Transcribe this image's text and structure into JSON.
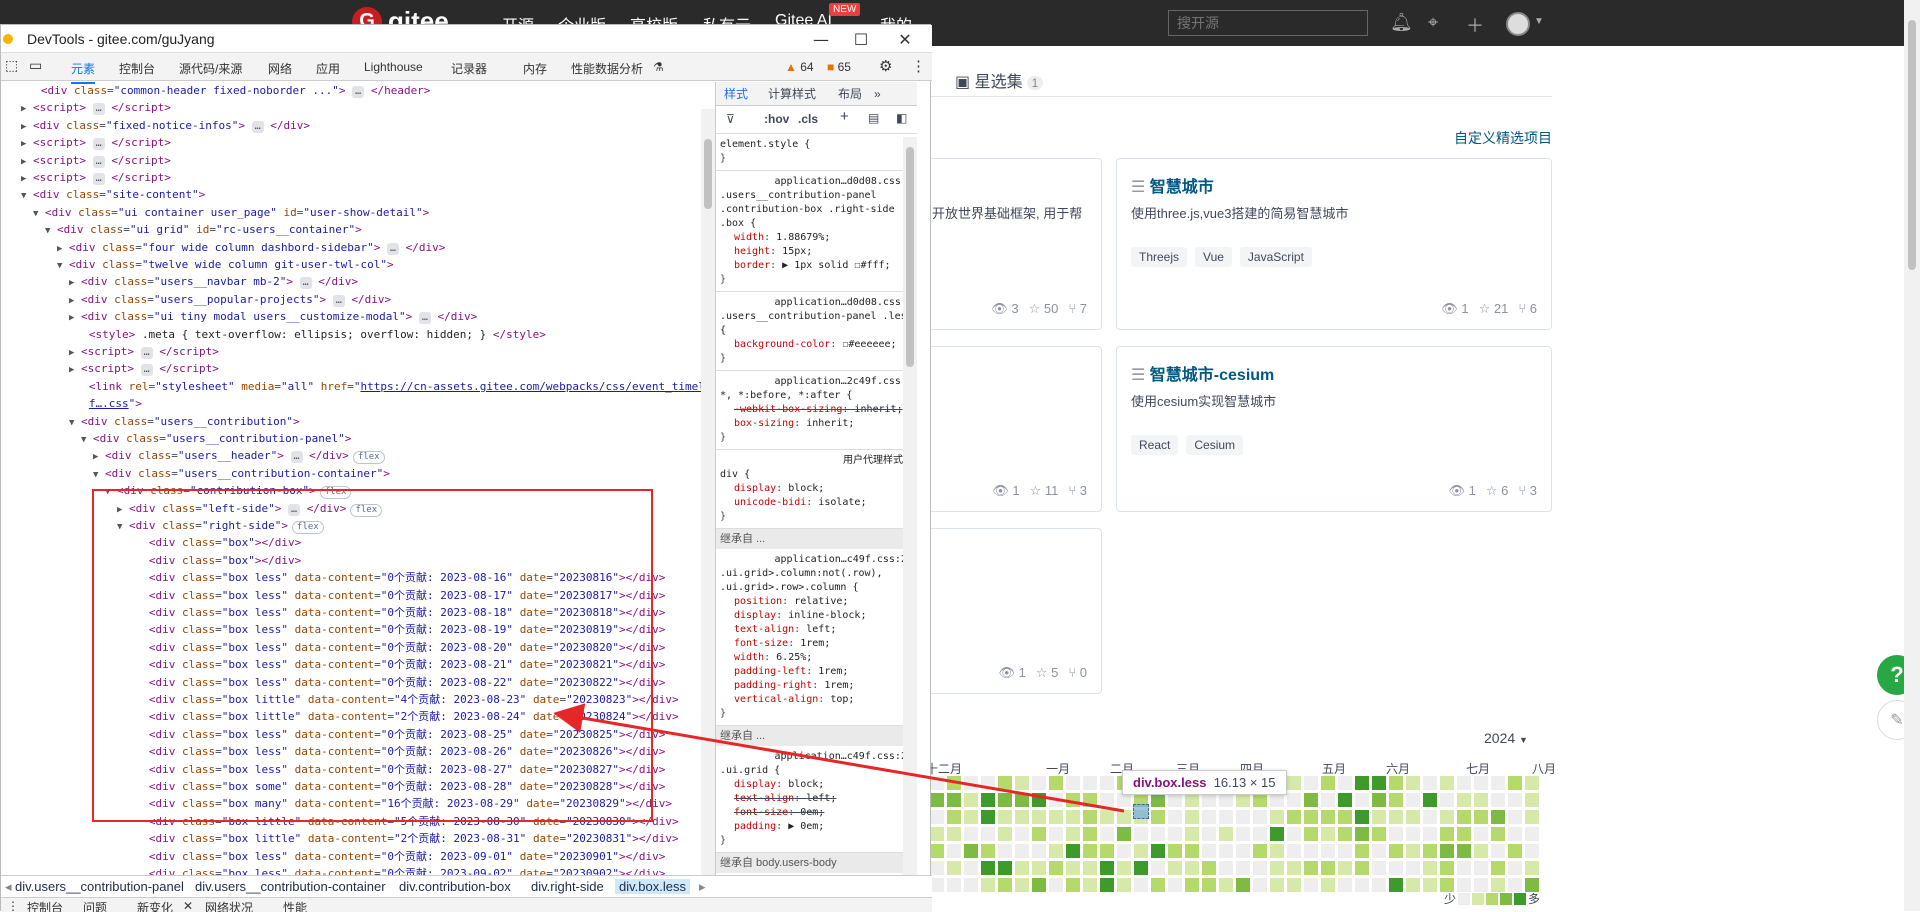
{
  "site": {
    "logo_text": "gitee",
    "nav": [
      "开源",
      "企业版",
      "高校版",
      "私有云",
      "Gitee AI",
      "我的"
    ],
    "new_badge": "NEW",
    "search_placeholder": "搜开源",
    "stars_tab": "星选集",
    "stars_count": "1",
    "custom_link": "自定义精选项目",
    "help_label": "?",
    "year": "2024",
    "months": [
      "十二月",
      "一月",
      "二月",
      "三月",
      "四月",
      "五月",
      "六月",
      "七月",
      "八月"
    ],
    "legend_less": "少",
    "legend_more": "多",
    "tooltip_tag": "div.box.less",
    "tooltip_size": "16.13 × 15",
    "colors": {
      "lvl0": "#eeeeee",
      "lvl1": "#d7e9a8",
      "lvl2": "#b5d96b",
      "lvl3": "#7dbb42",
      "lvl4": "#3d9a2b",
      "link": "#005980",
      "help": "#28a745"
    }
  },
  "cards": [
    {
      "title": "智慧城市",
      "desc": "使用three.js,vue3搭建的简易智慧城市",
      "tags": [
        "Threejs",
        "Vue",
        "JavaScript"
      ],
      "watch": "1",
      "star": "21",
      "fork": "6"
    },
    {
      "title": "智慧城市-cesium",
      "desc": "使用cesium实现智慧城市",
      "tags": [
        "React",
        "Cesium"
      ],
      "watch": "1",
      "star": "6",
      "fork": "3"
    }
  ],
  "left_cards": [
    {
      "desc": "开放世界基础框架, 用于帮",
      "watch": "3",
      "star": "50",
      "fork": "7"
    },
    {
      "desc": "",
      "watch": "1",
      "star": "11",
      "fork": "3"
    },
    {
      "desc": "",
      "watch": "1",
      "star": "5",
      "fork": "0"
    }
  ],
  "devtools": {
    "title": "DevTools - gitee.com/guJyang",
    "tabs": [
      "元素",
      "控制台",
      "源代码/来源",
      "网络",
      "应用",
      "Lighthouse",
      "记录器",
      "内存",
      "性能数据分析"
    ],
    "warn_count": "64",
    "issue_count": "65",
    "styles_tabs": [
      "样式",
      "计算样式",
      "布局"
    ],
    "filter_hov": ":hov",
    "filter_cls": ".cls",
    "breadcrumbs": [
      "div.users__contribution-panel",
      "div.users__contribution-container",
      "div.contribution-box",
      "div.right-side",
      "div.box.less"
    ],
    "drawer": [
      "控制台",
      "问题",
      "新变化",
      "网络状况",
      "性能"
    ]
  },
  "dom_lines": [
    {
      "d": 1,
      "a": "",
      "h": "<span class='tg'>&lt;div</span> <span class='at'>class</span>=<span class='av'>\"common-header fixed-noborder ...\"</span><span class='tg'>&gt;</span> <span class='ell'>…</span> <span class='tg'>&lt;/header&gt;</span>"
    },
    {
      "d": 1,
      "a": "▶",
      "h": "<span class='tg'>&lt;script&gt;</span> <span class='ell'>…</span> <span class='tg'>&lt;/script&gt;</span>"
    },
    {
      "d": 1,
      "a": "▶",
      "h": "<span class='tg'>&lt;div</span> <span class='at'>class</span>=<span class='av'>\"fixed-notice-infos\"</span><span class='tg'>&gt;</span> <span class='ell'>…</span> <span class='tg'>&lt;/div&gt;</span>"
    },
    {
      "d": 1,
      "a": "▶",
      "h": "<span class='tg'>&lt;script&gt;</span> <span class='ell'>…</span> <span class='tg'>&lt;/script&gt;</span>"
    },
    {
      "d": 1,
      "a": "▶",
      "h": "<span class='tg'>&lt;script&gt;</span> <span class='ell'>…</span> <span class='tg'>&lt;/script&gt;</span>"
    },
    {
      "d": 1,
      "a": "▶",
      "h": "<span class='tg'>&lt;script&gt;</span> <span class='ell'>…</span> <span class='tg'>&lt;/script&gt;</span>"
    },
    {
      "d": 1,
      "a": "▼",
      "h": "<span class='tg'>&lt;div</span> <span class='at'>class</span>=<span class='av'>\"site-content\"</span><span class='tg'>&gt;</span>"
    },
    {
      "d": 2,
      "a": "▼",
      "h": "<span class='tg'>&lt;div</span> <span class='at'>class</span>=<span class='av'>\"ui container user_page\"</span> <span class='at'>id</span>=<span class='av'>\"user-show-detail\"</span><span class='tg'>&gt;</span>"
    },
    {
      "d": 3,
      "a": "▼",
      "h": "<span class='tg'>&lt;div</span> <span class='at'>class</span>=<span class='av'>\"ui grid\"</span> <span class='at'>id</span>=<span class='av'>\"rc-users__container\"</span><span class='tg'>&gt;</span>"
    },
    {
      "d": 4,
      "a": "▶",
      "h": "<span class='tg'>&lt;div</span> <span class='at'>class</span>=<span class='av'>\"four wide column dashbord-sidebar\"</span><span class='tg'>&gt;</span> <span class='ell'>…</span> <span class='tg'>&lt;/div&gt;</span>"
    },
    {
      "d": 4,
      "a": "▼",
      "h": "<span class='tg'>&lt;div</span> <span class='at'>class</span>=<span class='av'>\"twelve wide column git-user-twl-col\"</span><span class='tg'>&gt;</span>"
    },
    {
      "d": 5,
      "a": "▶",
      "h": "<span class='tg'>&lt;div</span> <span class='at'>class</span>=<span class='av'>\"users__navbar mb-2\"</span><span class='tg'>&gt;</span> <span class='ell'>…</span> <span class='tg'>&lt;/div&gt;</span>"
    },
    {
      "d": 5,
      "a": "▶",
      "h": "<span class='tg'>&lt;div</span> <span class='at'>class</span>=<span class='av'>\"users__popular-projects\"</span><span class='tg'>&gt;</span> <span class='ell'>…</span> <span class='tg'>&lt;/div&gt;</span>"
    },
    {
      "d": 5,
      "a": "▶",
      "h": "<span class='tg'>&lt;div</span> <span class='at'>class</span>=<span class='av'>\"ui tiny modal users__customize-modal\"</span><span class='tg'>&gt;</span> <span class='ell'>…</span> <span class='tg'>&lt;/div&gt;</span>"
    },
    {
      "d": 5,
      "a": "",
      "h": "<span class='tg'>&lt;style&gt;</span> <span class='tx'>.meta { text-overflow: ellipsis; overflow: hidden; }</span> <span class='tg'>&lt;/style&gt;</span>"
    },
    {
      "d": 5,
      "a": "▶",
      "h": "<span class='tg'>&lt;script&gt;</span> <span class='ell'>…</span> <span class='tg'>&lt;/script&gt;</span>"
    },
    {
      "d": 5,
      "a": "▶",
      "h": "<span class='tg'>&lt;script&gt;</span> <span class='ell'>…</span> <span class='tg'>&lt;/script&gt;</span>"
    },
    {
      "d": 5,
      "a": "",
      "h": "<span class='tg'>&lt;link</span> <span class='at'>rel</span>=<span class='av'>\"stylesheet\"</span> <span class='at'>media</span>=<span class='av'>\"all\"</span> <span class='at'>href</span>=<span class='av'>\"</span><span class='lnk'>https://cn-assets.gitee.com/webpacks/css/event_timeline-adbd25</span>"
    },
    {
      "d": 5,
      "a": "",
      "h": "<span class='lnk'>f….css</span><span class='av'>\"</span><span class='tg'>&gt;</span>"
    },
    {
      "d": 5,
      "a": "▼",
      "h": "<span class='tg'>&lt;div</span> <span class='at'>class</span>=<span class='av'>\"users__contribution\"</span><span class='tg'>&gt;</span>"
    },
    {
      "d": 6,
      "a": "▼",
      "h": "<span class='tg'>&lt;div</span> <span class='at'>class</span>=<span class='av'>\"users__contribution-panel\"</span><span class='tg'>&gt;</span>"
    },
    {
      "d": 7,
      "a": "▶",
      "h": "<span class='tg'>&lt;div</span> <span class='at'>class</span>=<span class='av'>\"users__header\"</span><span class='tg'>&gt;</span> <span class='ell'>…</span> <span class='tg'>&lt;/div&gt;</span><span class='flex'>flex</span>"
    },
    {
      "d": 7,
      "a": "▼",
      "h": "<span class='tg'>&lt;div</span> <span class='at'>class</span>=<span class='av'>\"users__contribution-container\"</span><span class='tg'>&gt;</span>"
    },
    {
      "d": 8,
      "a": "▼",
      "h": "<span class='tg'>&lt;div</span> <span class='at'>class</span>=<span class='av'>\"contribution-box\"</span><span class='tg'>&gt;</span><span class='flex'>flex</span>"
    },
    {
      "d": 9,
      "a": "▶",
      "h": "<span class='tg'>&lt;div</span> <span class='at'>class</span>=<span class='av'>\"left-side\"</span><span class='tg'>&gt;</span> <span class='ell'>…</span> <span class='tg'>&lt;/div&gt;</span><span class='flex'>flex</span>"
    },
    {
      "d": 9,
      "a": "▼",
      "h": "<span class='tg'>&lt;div</span> <span class='at'>class</span>=<span class='av'>\"right-side\"</span><span class='tg'>&gt;</span><span class='flex'>flex</span>"
    },
    {
      "d": 10,
      "a": "",
      "h": "<span class='tg'>&lt;div</span> <span class='at'>class</span>=<span class='av'>\"box\"</span><span class='tg'>&gt;&lt;/div&gt;</span>"
    },
    {
      "d": 10,
      "a": "",
      "h": "<span class='tg'>&lt;div</span> <span class='at'>class</span>=<span class='av'>\"box\"</span><span class='tg'>&gt;&lt;/div&gt;</span>"
    },
    {
      "d": 10,
      "a": "",
      "h": "<span class='tg'>&lt;div</span> <span class='at'>class</span>=<span class='av'>\"box less\"</span> <span class='at'>data-content</span>=<span class='av'>\"0个贡献: 2023-08-16\"</span> <span class='at'>date</span>=<span class='av'>\"20230816\"</span><span class='tg'>&gt;&lt;/div&gt;</span>"
    },
    {
      "d": 10,
      "a": "",
      "h": "<span class='tg'>&lt;div</span> <span class='at'>class</span>=<span class='av'>\"box less\"</span> <span class='at'>data-content</span>=<span class='av'>\"0个贡献: 2023-08-17\"</span> <span class='at'>date</span>=<span class='av'>\"20230817\"</span><span class='tg'>&gt;&lt;/div&gt;</span>"
    },
    {
      "d": 10,
      "a": "",
      "h": "<span class='tg'>&lt;div</span> <span class='at'>class</span>=<span class='av'>\"box less\"</span> <span class='at'>data-content</span>=<span class='av'>\"0个贡献: 2023-08-18\"</span> <span class='at'>date</span>=<span class='av'>\"20230818\"</span><span class='tg'>&gt;&lt;/div&gt;</span>"
    },
    {
      "d": 10,
      "a": "",
      "h": "<span class='tg'>&lt;div</span> <span class='at'>class</span>=<span class='av'>\"box less\"</span> <span class='at'>data-content</span>=<span class='av'>\"0个贡献: 2023-08-19\"</span> <span class='at'>date</span>=<span class='av'>\"20230819\"</span><span class='tg'>&gt;&lt;/div&gt;</span>"
    },
    {
      "d": 10,
      "a": "",
      "h": "<span class='tg'>&lt;div</span> <span class='at'>class</span>=<span class='av'>\"box less\"</span> <span class='at'>data-content</span>=<span class='av'>\"0个贡献: 2023-08-20\"</span> <span class='at'>date</span>=<span class='av'>\"20230820\"</span><span class='tg'>&gt;&lt;/div&gt;</span>"
    },
    {
      "d": 10,
      "a": "",
      "h": "<span class='tg'>&lt;div</span> <span class='at'>class</span>=<span class='av'>\"box less\"</span> <span class='at'>data-content</span>=<span class='av'>\"0个贡献: 2023-08-21\"</span> <span class='at'>date</span>=<span class='av'>\"20230821\"</span><span class='tg'>&gt;&lt;/div&gt;</span>"
    },
    {
      "d": 10,
      "a": "",
      "h": "<span class='tg'>&lt;div</span> <span class='at'>class</span>=<span class='av'>\"box less\"</span> <span class='at'>data-content</span>=<span class='av'>\"0个贡献: 2023-08-22\"</span> <span class='at'>date</span>=<span class='av'>\"20230822\"</span><span class='tg'>&gt;&lt;/div&gt;</span>"
    },
    {
      "d": 10,
      "a": "",
      "h": "<span class='tg'>&lt;div</span> <span class='at'>class</span>=<span class='av'>\"box little\"</span> <span class='at'>data-content</span>=<span class='av'>\"4个贡献: 2023-08-23\"</span> <span class='at'>date</span>=<span class='av'>\"20230823\"</span><span class='tg'>&gt;&lt;/div&gt;</span>"
    },
    {
      "d": 10,
      "a": "",
      "h": "<span class='tg'>&lt;div</span> <span class='at'>class</span>=<span class='av'>\"box little\"</span> <span class='at'>data-content</span>=<span class='av'>\"2个贡献: 2023-08-24\"</span> <span class='at'>date</span>=<span class='av'>\"20230824\"</span><span class='tg'>&gt;&lt;/div&gt;</span>"
    },
    {
      "d": 10,
      "a": "",
      "h": "<span class='tg'>&lt;div</span> <span class='at'>class</span>=<span class='av'>\"box less\"</span> <span class='at'>data-content</span>=<span class='av'>\"0个贡献: 2023-08-25\"</span> <span class='at'>date</span>=<span class='av'>\"20230825\"</span><span class='tg'>&gt;&lt;/div&gt;</span>"
    },
    {
      "d": 10,
      "a": "",
      "h": "<span class='tg'>&lt;div</span> <span class='at'>class</span>=<span class='av'>\"box less\"</span> <span class='at'>data-content</span>=<span class='av'>\"0个贡献: 2023-08-26\"</span> <span class='at'>date</span>=<span class='av'>\"20230826\"</span><span class='tg'>&gt;&lt;/div&gt;</span>"
    },
    {
      "d": 10,
      "a": "",
      "h": "<span class='tg'>&lt;div</span> <span class='at'>class</span>=<span class='av'>\"box less\"</span> <span class='at'>data-content</span>=<span class='av'>\"0个贡献: 2023-08-27\"</span> <span class='at'>date</span>=<span class='av'>\"20230827\"</span><span class='tg'>&gt;&lt;/div&gt;</span>"
    },
    {
      "d": 10,
      "a": "",
      "h": "<span class='tg'>&lt;div</span> <span class='at'>class</span>=<span class='av'>\"box some\"</span> <span class='at'>data-content</span>=<span class='av'>\"0个贡献: 2023-08-28\"</span> <span class='at'>date</span>=<span class='av'>\"20230828\"</span><span class='tg'>&gt;&lt;/div&gt;</span>"
    },
    {
      "d": 10,
      "a": "",
      "h": "<span class='tg'>&lt;div</span> <span class='at'>class</span>=<span class='av'>\"box many\"</span> <span class='at'>data-content</span>=<span class='av'>\"16个贡献: 2023-08-29\"</span> <span class='at'>date</span>=<span class='av'>\"20230829\"</span><span class='tg'>&gt;&lt;/div&gt;</span>"
    },
    {
      "d": 10,
      "a": "",
      "h": "<span class='tg'>&lt;div</span> <span class='at'>class</span>=<span class='av'>\"box little\"</span> <span class='at'>data-content</span>=<span class='av'>\"5个贡献: 2023-08-30\"</span> <span class='at'>date</span>=<span class='av'>\"20230830\"</span><span class='tg'>&gt;&lt;/div&gt;</span>"
    },
    {
      "d": 10,
      "a": "",
      "h": "<span class='tg'>&lt;div</span> <span class='at'>class</span>=<span class='av'>\"box little\"</span> <span class='at'>data-content</span>=<span class='av'>\"2个贡献: 2023-08-31\"</span> <span class='at'>date</span>=<span class='av'>\"20230831\"</span><span class='tg'>&gt;&lt;/div&gt;</span>"
    },
    {
      "d": 10,
      "a": "",
      "h": "<span class='tg'>&lt;div</span> <span class='at'>class</span>=<span class='av'>\"box less\"</span> <span class='at'>data-content</span>=<span class='av'>\"0个贡献: 2023-09-01\"</span> <span class='at'>date</span>=<span class='av'>\"20230901\"</span><span class='tg'>&gt;&lt;/div&gt;</span>"
    },
    {
      "d": 10,
      "a": "",
      "h": "<span class='tg'>&lt;div</span> <span class='at'>class</span>=<span class='av'>\"box less\"</span> <span class='at'>data-content</span>=<span class='av'>\"0个贡献: 2023-09-02\"</span> <span class='at'>date</span>=<span class='av'>\"20230902\"</span><span class='tg'>&gt;&lt;/div&gt;</span>"
    }
  ],
  "style_rules": [
    {
      "src": "element.style {",
      "sel": "",
      "props": [],
      "close": "}"
    },
    {
      "src": "application…d0d08.css:1",
      "sel": ".users__contribution-panel .contribution-box .right-side .box {",
      "props": [
        [
          "width",
          "1.88679%;",
          false
        ],
        [
          "height",
          "15px;",
          false
        ],
        [
          "border",
          "▶ 1px solid ☐#fff;",
          false
        ]
      ],
      "close": "}"
    },
    {
      "src": "application…d0d08.css:1",
      "sel": ".users__contribution-panel .less {",
      "props": [
        [
          "background-color",
          "☐#eeeeee;",
          false
        ]
      ],
      "close": "}"
    },
    {
      "src": "application…2c49f.css:1",
      "sel": "*, *:before, *:after {",
      "props": [
        [
          "-webkit-box-sizing",
          "inherit;",
          true
        ],
        [
          "box-sizing",
          "inherit;",
          false
        ]
      ],
      "close": "}"
    },
    {
      "src": "用户代理样式表",
      "sel": "div {",
      "props": [
        [
          "display",
          "block;",
          false
        ],
        [
          "unicode-bidi",
          "isolate;",
          false
        ]
      ],
      "close": "}"
    },
    {
      "src": "inherit:继承自 ...",
      "sel": "",
      "props": [],
      "close": ""
    },
    {
      "src": "application…c49f.css:25",
      "sel": ".ui.grid>.column:not(.row), .ui.grid>.row>.column {",
      "props": [
        [
          "position",
          "relative;",
          false
        ],
        [
          "display",
          "inline-block;",
          false
        ],
        [
          "text-align",
          "left;",
          false
        ],
        [
          "font-size",
          "1rem;",
          false
        ],
        [
          "width",
          "6.25%;",
          false
        ],
        [
          "padding-left",
          "1rem;",
          false
        ],
        [
          "padding-right",
          "1rem;",
          false
        ],
        [
          "vertical-align",
          "top;",
          false
        ]
      ],
      "close": "}"
    },
    {
      "src": "inherit:继承自 ...",
      "sel": "",
      "props": [],
      "close": ""
    },
    {
      "src": "application…c49f.css:25",
      "sel": ".ui.grid {",
      "props": [
        [
          "display",
          "block;",
          false
        ],
        [
          "text-align",
          "left;",
          true
        ],
        [
          "font-size",
          "0em;",
          true
        ],
        [
          "padding",
          "▶ 0em;",
          false
        ]
      ],
      "close": "}"
    },
    {
      "src": "inherit:继承自 body.users-body",
      "sel": "",
      "props": [],
      "close": ""
    }
  ]
}
